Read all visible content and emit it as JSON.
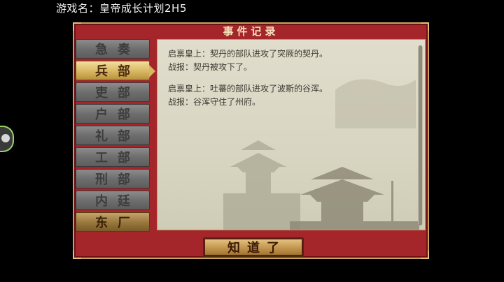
{
  "caption": "游戏名：皇帝成长计划2H5",
  "dialog": {
    "title": "事件记录",
    "tabs": [
      {
        "label": "急奏"
      },
      {
        "label": "兵部"
      },
      {
        "label": "吏部"
      },
      {
        "label": "户部"
      },
      {
        "label": "礼部"
      },
      {
        "label": "工部"
      },
      {
        "label": "刑部"
      },
      {
        "label": "内廷"
      },
      {
        "label": "东厂"
      }
    ],
    "active_tab": "兵部",
    "entries": [
      {
        "report": "启禀皇上：契丹的部队进攻了突厥的契丹。",
        "result": "战报：契丹被攻下了。"
      },
      {
        "report": "启禀皇上：吐蕃的部队进攻了波斯的谷浑。",
        "result": "战报：谷浑守住了州府。"
      }
    ],
    "confirm_label": "知道了"
  },
  "icons": {
    "side_handle": "floating-menu-icon",
    "background_art": "pavilion-silhouette-icon"
  },
  "colors": {
    "panel_red": "#a4252a",
    "gold": "#d8b762",
    "parchment": "#d8d5c2"
  }
}
